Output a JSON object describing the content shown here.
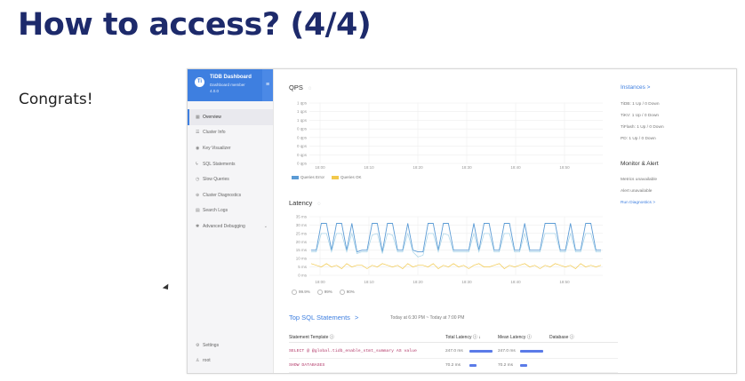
{
  "slide": {
    "title": "How to access? (4/4)",
    "text": "Congrats!"
  },
  "colors": {
    "title": "#1d2a6b",
    "brand": "#3e7fe0",
    "queries_error": "#5b9bd5",
    "queries_ok": "#f2c94c",
    "latency_primary": "#5b9bd5",
    "latency_secondary": "#a7d3e8",
    "latency_tertiary": "#f2c94c"
  },
  "dashboard": {
    "brand": {
      "logo": "Ti",
      "title": "TiDB Dashboard",
      "subtitle": "Dashboard member",
      "version": "4.0.0",
      "menu_icon": "hamburger-icon"
    },
    "nav": [
      {
        "label": "Overview",
        "icon": "grid-icon",
        "active": true
      },
      {
        "label": "Cluster Info",
        "icon": "server-icon"
      },
      {
        "label": "Key Visualizer",
        "icon": "eye-icon"
      },
      {
        "label": "SQL Statements",
        "icon": "lightning-icon"
      },
      {
        "label": "Slow Queries",
        "icon": "clock-icon"
      },
      {
        "label": "Cluster Diagnostics",
        "icon": "stethoscope-icon"
      },
      {
        "label": "Search Logs",
        "icon": "file-icon"
      },
      {
        "label": "Advanced Debugging",
        "icon": "bug-icon",
        "caret": "⌄"
      }
    ],
    "nav_bottom": [
      {
        "label": "Settings",
        "icon": "gear-icon"
      },
      {
        "label": "root",
        "icon": "user-icon"
      }
    ],
    "qps": {
      "title": "QPS",
      "y_ticks": [
        "1 qps",
        "1 qps",
        "1 qps",
        "0 qps",
        "0 qps",
        "0 qps",
        "0 qps",
        "0 qps"
      ],
      "x_ticks": [
        "18:00",
        "18:10",
        "18:20",
        "18:30",
        "18:40",
        "18:50"
      ],
      "legend": [
        "Queries Error",
        "Queries OK"
      ]
    },
    "latency": {
      "title": "Latency",
      "y_ticks": [
        "35 ms",
        "30 ms",
        "25 ms",
        "20 ms",
        "15 ms",
        "10 ms",
        "5 ms",
        "0 ms"
      ],
      "x_ticks": [
        "18:00",
        "18:10",
        "18:20",
        "18:30",
        "18:40",
        "18:50"
      ],
      "legend": [
        "99.9%",
        "99%",
        "90%"
      ]
    },
    "top_sql": {
      "title": "Top SQL Statements",
      "chevron": ">",
      "time_range": "Today at 6:30 PM ~ Today at 7:00 PM",
      "columns": [
        "Statement Template",
        "Total Latency",
        "Mean Latency",
        "Database"
      ],
      "rows": [
        {
          "sql": "SELECT @ @global.tidb_enable_stmt_summary AS value",
          "total": "247.0 ms",
          "mean": "247.0 ms",
          "total_frac": 1.0,
          "mean_frac": 1.0
        },
        {
          "sql": "SHOW DATABASES",
          "total": "70.2 ms",
          "mean": "70.2 ms",
          "total_frac": 0.3,
          "mean_frac": 0.3
        }
      ]
    },
    "instances": {
      "title": "Instances >",
      "rows": [
        "TiDB: 1 Up / 0 Down",
        "TiKV: 1 Up / 0 Down",
        "TiFlash: 1 Up / 0 Down",
        "PD: 1 Up / 0 Down"
      ]
    },
    "monitor": {
      "title": "Monitor & Alert",
      "rows": [
        "Metrics unavailable",
        "Alert unavailable"
      ],
      "link": "Run Diagnostics >"
    }
  },
  "chart_data": [
    {
      "type": "line",
      "title": "QPS",
      "x": [
        "18:00",
        "18:10",
        "18:20",
        "18:30",
        "18:40",
        "18:50"
      ],
      "y_ticks": [
        "1 qps",
        "1 qps",
        "1 qps",
        "0 qps",
        "0 qps",
        "0 qps",
        "0 qps",
        "0 qps"
      ],
      "series": [
        {
          "name": "Queries Error",
          "values": []
        },
        {
          "name": "Queries OK",
          "values": []
        }
      ],
      "grid": true,
      "legend": "bottom-left"
    },
    {
      "type": "line",
      "title": "Latency",
      "x": [
        "18:00",
        "18:10",
        "18:20",
        "18:30",
        "18:40",
        "18:50"
      ],
      "ylim": [
        0,
        35
      ],
      "series": [
        {
          "name": "99.9%",
          "values": [
            15,
            15,
            31,
            31,
            15,
            31,
            31,
            15,
            31,
            14,
            15,
            15,
            31,
            31,
            14,
            31,
            31,
            15,
            15,
            31,
            15,
            14,
            14,
            31,
            31,
            15,
            31,
            31,
            15,
            15,
            15,
            15,
            31,
            15,
            31,
            31,
            15,
            15,
            31,
            31,
            15,
            15,
            31,
            15,
            15,
            15,
            31,
            31,
            31,
            15,
            15,
            31,
            15,
            15,
            31,
            31,
            15,
            15
          ]
        },
        {
          "name": "99%",
          "values": [
            14,
            14,
            25,
            25,
            14,
            25,
            25,
            14,
            25,
            13,
            14,
            14,
            24,
            25,
            13,
            25,
            24,
            14,
            14,
            25,
            14,
            11,
            12,
            25,
            25,
            14,
            25,
            24,
            14,
            14,
            14,
            14,
            25,
            14,
            25,
            25,
            14,
            14,
            25,
            25,
            14,
            14,
            25,
            14,
            14,
            14,
            25,
            25,
            25,
            14,
            14,
            25,
            14,
            14,
            25,
            25,
            14,
            14
          ]
        },
        {
          "name": "90%",
          "values": [
            7,
            6,
            5,
            7,
            5,
            6,
            4,
            7,
            5,
            6,
            6,
            4,
            6,
            5,
            7,
            6,
            5,
            6,
            4,
            7,
            5,
            6,
            6,
            5,
            7,
            4,
            6,
            5,
            7,
            5,
            6,
            4,
            6,
            7,
            5,
            5,
            6,
            7,
            4,
            6,
            5,
            6,
            7,
            5,
            6,
            4,
            6,
            5,
            7,
            6,
            5,
            6,
            4,
            7,
            5,
            6,
            5,
            6
          ]
        }
      ],
      "grid": true,
      "legend": "bottom-left"
    }
  ]
}
